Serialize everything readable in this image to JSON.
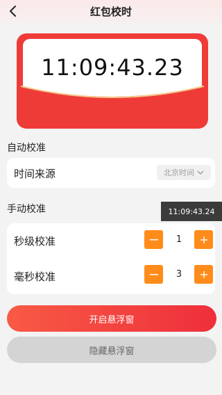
{
  "header": {
    "title": "红包校时"
  },
  "hero": {
    "time": "11:09:43.23"
  },
  "auto": {
    "section_title": "自动校准",
    "source_label": "时间来源",
    "source_value": "北京时间"
  },
  "manual": {
    "section_title": "手动校准",
    "floating_time": "11:09:43.24",
    "seconds": {
      "label": "秒级校准",
      "value": "1"
    },
    "milliseconds": {
      "label": "毫秒校准",
      "value": "3"
    }
  },
  "actions": {
    "open_float": "开启悬浮窗",
    "hide_float": "隐藏悬浮窗"
  },
  "colors": {
    "accent_red": "#ef3b37",
    "stepper_orange": "#ff8c1a"
  }
}
